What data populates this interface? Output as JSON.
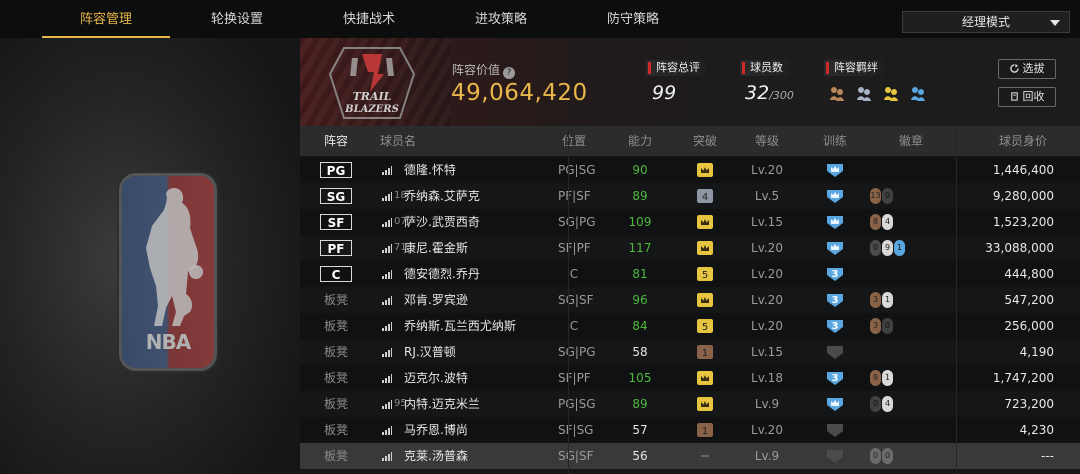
{
  "tabs": [
    {
      "label": "阵容管理",
      "active": true
    },
    {
      "label": "轮换设置",
      "active": false
    },
    {
      "label": "快捷战术",
      "active": false
    },
    {
      "label": "进攻策略",
      "active": false
    },
    {
      "label": "防守策略",
      "active": false
    }
  ],
  "mode_select": {
    "value": "经理模式"
  },
  "team": {
    "logo_text": [
      "TRAIL",
      "BLAZERS"
    ],
    "league_logo_text": "NBA"
  },
  "summary": {
    "value_label": "阵容价值",
    "value": "49,064,420",
    "rating_label": "阵容总评",
    "rating": "99",
    "players_label": "球员数",
    "players": "32",
    "players_max": "/300",
    "bond_label": "阵容羁绊"
  },
  "buttons": {
    "pick": "选拔",
    "recycle": "回收"
  },
  "columns": [
    "阵容",
    "球员名",
    "位置",
    "能力",
    "突破",
    "等级",
    "训练",
    "徽章",
    "球员身价"
  ],
  "players": [
    {
      "slot": "PG",
      "starter": true,
      "num": "",
      "name": "德隆.怀特",
      "pos": "PG|SG",
      "ovr": "90",
      "ovr_green": true,
      "breakthrough": "crown",
      "level": "Lv.20",
      "train": "crown",
      "badges": [],
      "value": "1,446,400"
    },
    {
      "slot": "SG",
      "starter": true,
      "num": "18",
      "name": "乔纳森.艾萨克",
      "pos": "PF|SF",
      "ovr": "89",
      "ovr_green": true,
      "breakthrough": "4",
      "level": "Lv.5",
      "train": "crown",
      "badges": [
        "13",
        "0"
      ],
      "value": "9,280,000"
    },
    {
      "slot": "SF",
      "starter": true,
      "num": "07",
      "name": "萨沙.武贾西奇",
      "pos": "SG|PG",
      "ovr": "109",
      "ovr_green": true,
      "breakthrough": "crown",
      "level": "Lv.15",
      "train": "crown",
      "badges": [
        "8",
        "4"
      ],
      "value": "1,523,200"
    },
    {
      "slot": "PF",
      "starter": true,
      "num": "71",
      "name": "康尼.霍金斯",
      "pos": "SF|PF",
      "ovr": "117",
      "ovr_green": true,
      "breakthrough": "crown",
      "level": "Lv.20",
      "train": "crown",
      "badges": [
        "0",
        "9",
        "1"
      ],
      "value": "33,088,000"
    },
    {
      "slot": "C",
      "starter": true,
      "num": "",
      "name": "德安德烈.乔丹",
      "pos": "C",
      "ovr": "81",
      "ovr_green": true,
      "breakthrough": "5",
      "level": "Lv.20",
      "train": "3",
      "badges": [],
      "value": "444,800"
    },
    {
      "slot": "板凳",
      "starter": false,
      "num": "",
      "name": "邓肯.罗宾逊",
      "pos": "SG|SF",
      "ovr": "96",
      "ovr_green": true,
      "breakthrough": "crown",
      "level": "Lv.20",
      "train": "3",
      "badges": [
        "3",
        "1"
      ],
      "value": "547,200"
    },
    {
      "slot": "板凳",
      "starter": false,
      "num": "",
      "name": "乔纳斯.瓦兰西尤纳斯",
      "pos": "C",
      "ovr": "84",
      "ovr_green": true,
      "breakthrough": "5",
      "level": "Lv.20",
      "train": "3",
      "badges": [
        "3",
        "0"
      ],
      "value": "256,000"
    },
    {
      "slot": "板凳",
      "starter": false,
      "num": "",
      "name": "RJ.汉普顿",
      "pos": "SG|PG",
      "ovr": "58",
      "ovr_green": false,
      "breakthrough": "1",
      "level": "Lv.15",
      "train": "none",
      "badges": [],
      "value": "4,190"
    },
    {
      "slot": "板凳",
      "starter": false,
      "num": "",
      "name": "迈克尔.波特",
      "pos": "SF|PF",
      "ovr": "105",
      "ovr_green": true,
      "breakthrough": "crown",
      "level": "Lv.18",
      "train": "3",
      "badges": [
        "9",
        "1"
      ],
      "value": "1,747,200"
    },
    {
      "slot": "板凳",
      "starter": false,
      "num": "95",
      "name": "内特.迈克米兰",
      "pos": "PG|SG",
      "ovr": "89",
      "ovr_green": true,
      "breakthrough": "crown",
      "level": "Lv.9",
      "train": "crown",
      "badges": [
        "0",
        "4"
      ],
      "value": "723,200"
    },
    {
      "slot": "板凳",
      "starter": false,
      "num": "",
      "name": "马乔恩.博尚",
      "pos": "SF|SG",
      "ovr": "57",
      "ovr_green": false,
      "breakthrough": "1",
      "level": "Lv.20",
      "train": "none",
      "badges": [],
      "value": "4,230"
    },
    {
      "slot": "板凳",
      "starter": false,
      "num": "",
      "name": "克莱.汤普森",
      "pos": "SG|SF",
      "ovr": "56",
      "ovr_green": false,
      "breakthrough": "none",
      "level": "Lv.9",
      "train": "none",
      "badges": [
        "0",
        "0"
      ],
      "value": "---",
      "selected": true
    }
  ]
}
